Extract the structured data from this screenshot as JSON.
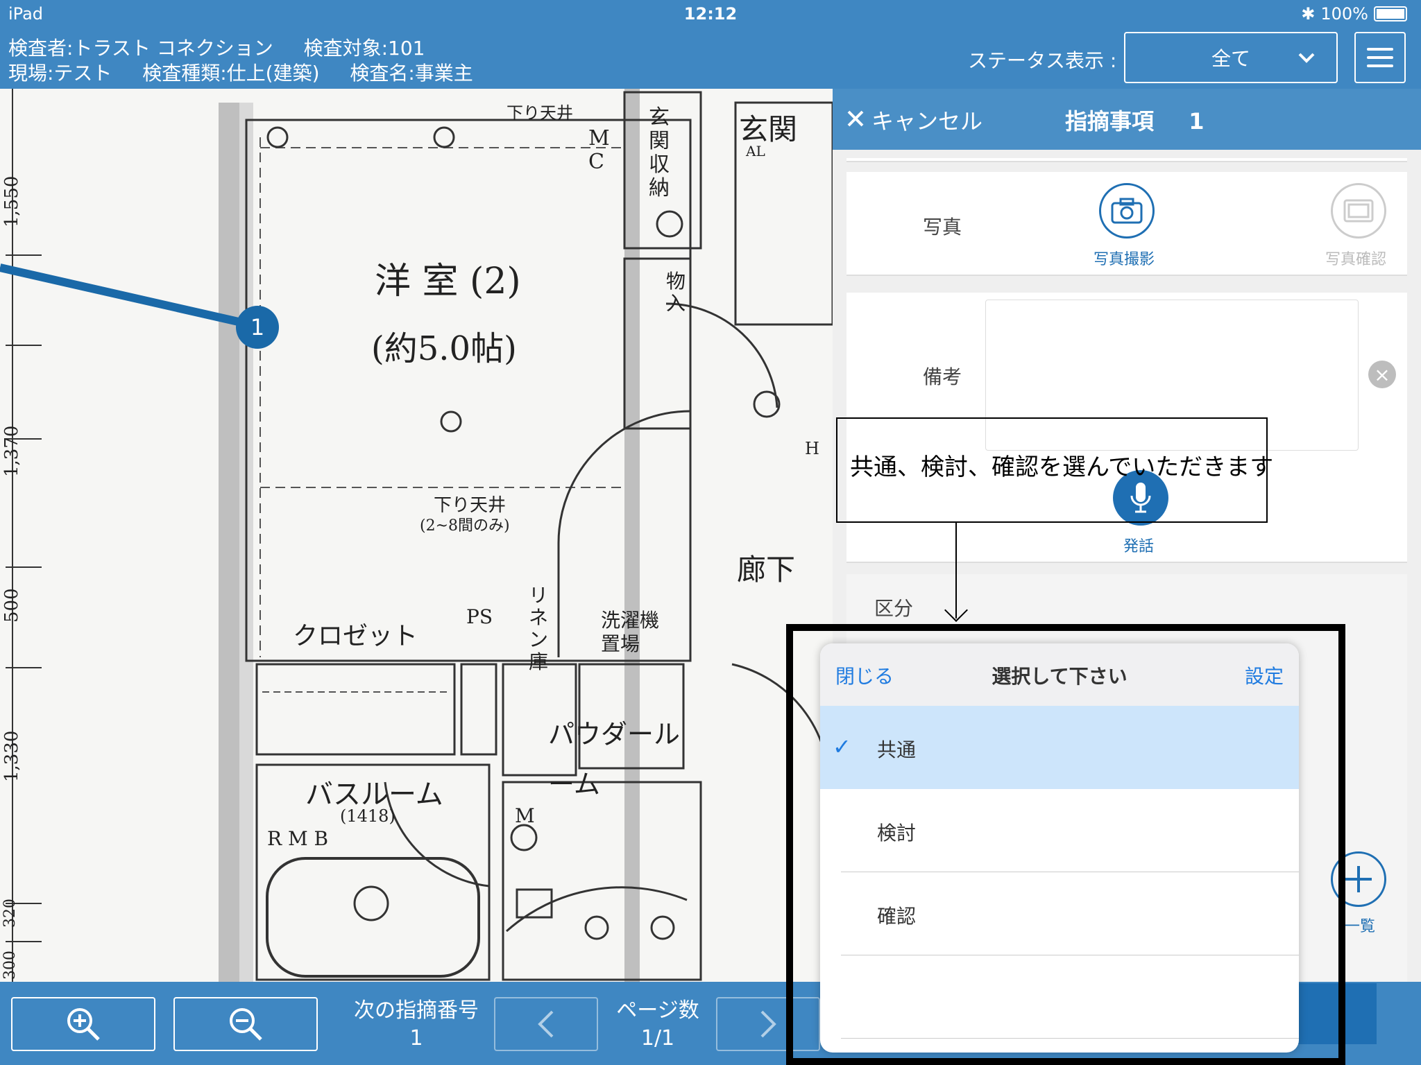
{
  "statusbar": {
    "device": "iPad",
    "time": "12:12",
    "battery": "100%"
  },
  "header": {
    "inspector": "検査者:トラスト コネクション",
    "target": "検査対象:101",
    "site": "現場:テスト",
    "type": "検査種類:仕上(建築)",
    "name": "検査名:事業主",
    "status_label": "ステータス表示 :",
    "status_value": "全て"
  },
  "plan": {
    "marker": "1",
    "dims": [
      "1,550",
      "1,370",
      "500",
      "1,330",
      "320",
      "300"
    ],
    "rooms": {
      "western": "洋 室 (2)",
      "western_size": "(約5.0帖)",
      "entrance": "玄関",
      "storage": "玄関収納",
      "corridor": "廊下",
      "closet": "クロゼット",
      "bath": "バスルーム",
      "bath_size": "(1418)",
      "powder": "パウダールーム",
      "linen": "リネン庫",
      "ps": "PS",
      "ceiling": "下り天井",
      "ceiling_note": "(2~8間のみ)",
      "laundry": "洗濯機置場",
      "mc": "M C",
      "h": "H",
      "m": "M",
      "rmb": "R M B",
      "al": "AL",
      "storage2": "物入",
      "top_ceiling": "下り天井"
    }
  },
  "panel": {
    "cancel": "キャンセル",
    "title": "指摘事項",
    "number": "1",
    "photo_label": "写真",
    "photo_take": "写真撮影",
    "photo_check": "写真確認",
    "remarks_label": "備考",
    "speak": "発話",
    "category_label": "区分",
    "list_label": "一覧"
  },
  "callout": "共通、検討、確認を選んでいただきます",
  "toolbar": {
    "next_label": "次の指摘番号",
    "next_value": "1",
    "page_label": "ページ数",
    "page_value": "1/1"
  },
  "picker": {
    "close": "閉じる",
    "title": "選択して下さい",
    "settings": "設定",
    "options": [
      "共通",
      "検討",
      "確認"
    ]
  },
  "colors": {
    "header": "#3f87c2",
    "primary": "#1f6fb3",
    "link": "#1f7be0",
    "selected": "#cde5fb"
  }
}
